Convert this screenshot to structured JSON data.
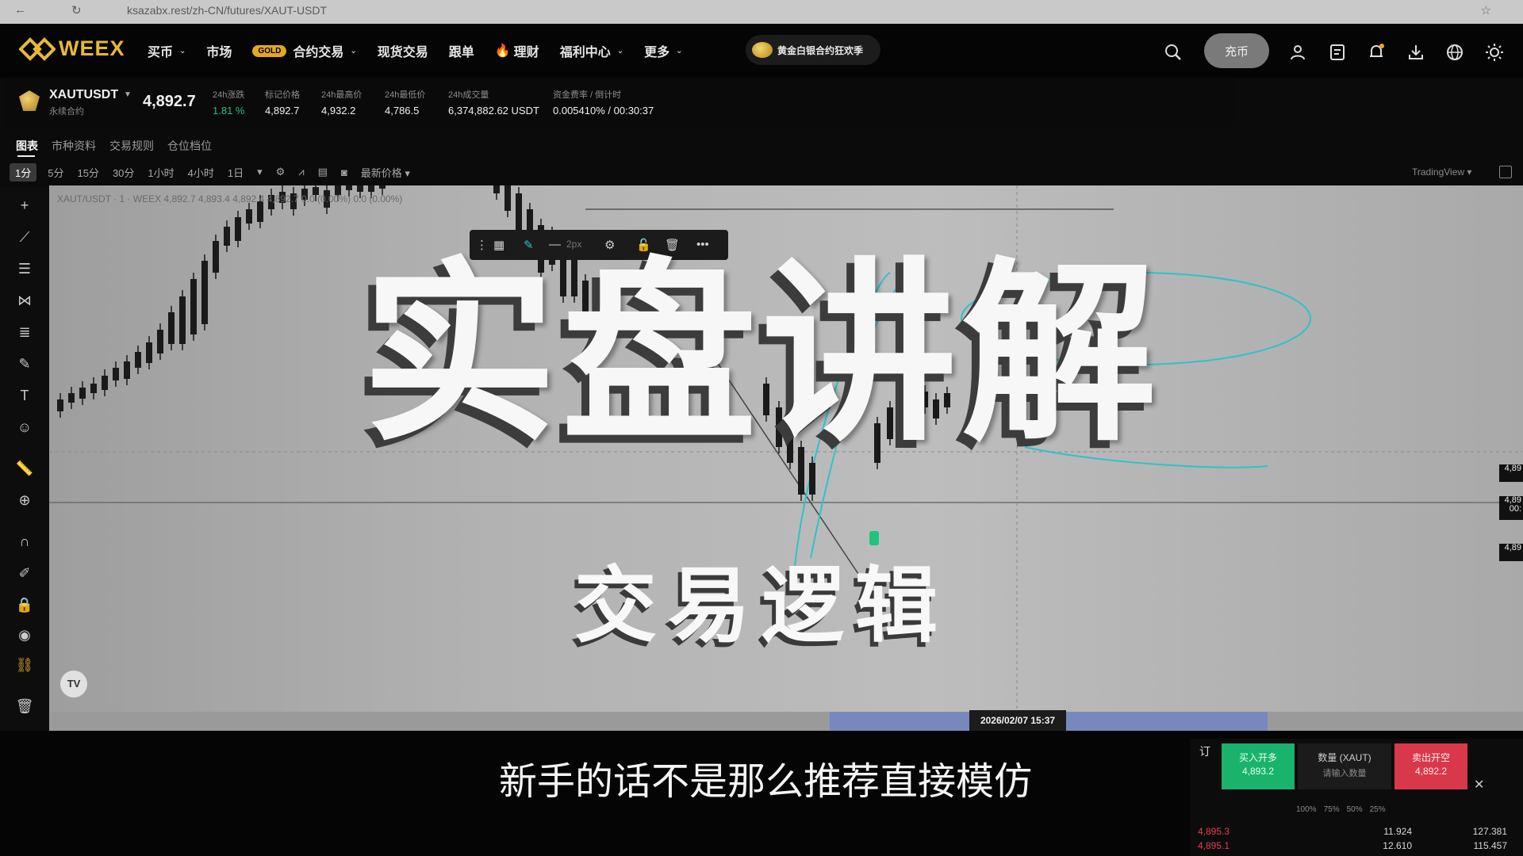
{
  "browser": {
    "url": "ksazabx.rest/zh-CN/futures/XAUT-USDT"
  },
  "nav": {
    "logo": "WEEX",
    "items": [
      {
        "label": "买币",
        "caret": true
      },
      {
        "label": "市场",
        "caret": false
      },
      {
        "label": "合约交易",
        "caret": true,
        "badge": "GOLD"
      },
      {
        "label": "现货交易",
        "caret": false
      },
      {
        "label": "跟单",
        "caret": false
      },
      {
        "label": "理财",
        "caret": false,
        "fire": true
      },
      {
        "label": "福利中心",
        "caret": true
      },
      {
        "label": "更多",
        "caret": true
      }
    ],
    "promo": "黄金白银合约狂欢季",
    "deposit": "充币"
  },
  "ticker": {
    "symbol": "XAUTUSDT",
    "subtitle": "永续合约",
    "last_price": "4,892.7",
    "stats": [
      {
        "label": "24h涨跌",
        "value": "1.81 %",
        "color": "#1fc47a"
      },
      {
        "label": "标记价格",
        "value": "4,892.7"
      },
      {
        "label": "24h最高价",
        "value": "4,932.2"
      },
      {
        "label": "24h最低价",
        "value": "4,786.5"
      },
      {
        "label": "24h成交量",
        "value": "6,374,882.62 USDT"
      },
      {
        "label": "资金费率 / 倒计时",
        "value": "0.005410% / 00:30:37"
      }
    ]
  },
  "subtabs": [
    "图表",
    "市种资料",
    "交易规则",
    "仓位档位"
  ],
  "timeframes": [
    "1分",
    "5分",
    "15分",
    "30分",
    "1小时",
    "4小时",
    "1日"
  ],
  "price_type": "最新价格",
  "tradingview_label": "TradingView",
  "chart": {
    "ohlc": "XAUT/USDT · 1 · WEEX   4,892.7   4,893.4   4,892.4   4,892.7   0.0 (0.00%)  0.0 (0.00%)",
    "draw_px": "2px",
    "date_label": "2026/02/07   15:37",
    "tv_logo": "TV",
    "price_tags": [
      "4,89",
      "4,89 00:",
      "4,89"
    ]
  },
  "overlay": {
    "title": "实盘讲解",
    "subtitle": "交易逻辑"
  },
  "caption": "新手的话不是那么推荐直接模仿",
  "order_panel": {
    "header": "订",
    "buy_label": "买入开多",
    "buy_price": "4,893.2",
    "qty_label": "数量 (XAUT)",
    "qty_placeholder": "请输入数量",
    "sell_label": "卖出开空",
    "sell_price": "4,892.2",
    "percents": [
      "100%",
      "75%",
      "50%",
      "25%"
    ],
    "book": [
      {
        "price": "4,895.3",
        "qty": "11.924",
        "total": "127.381"
      },
      {
        "price": "4,895.1",
        "qty": "12.610",
        "total": "115.457"
      }
    ]
  }
}
